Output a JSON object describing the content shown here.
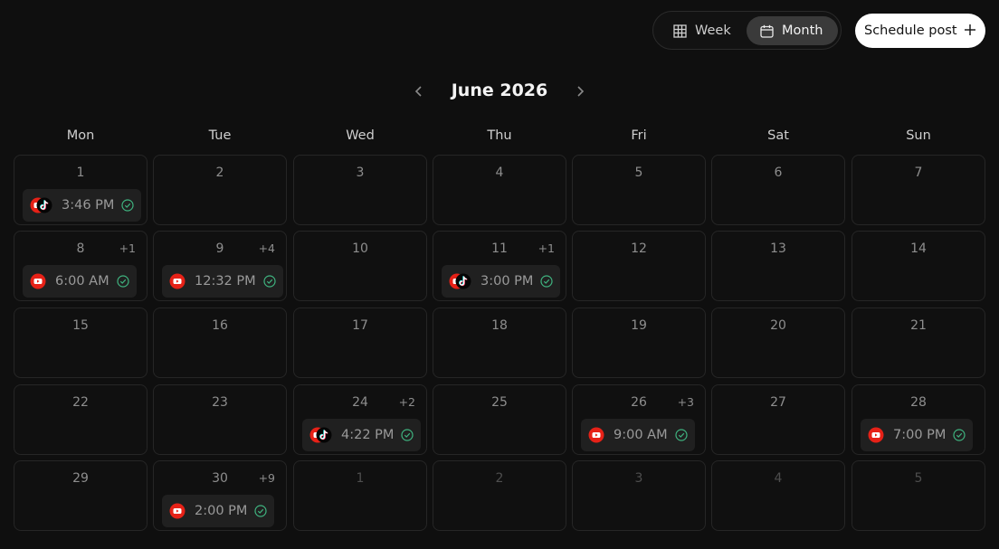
{
  "toolbar": {
    "week_label": "Week",
    "month_label": "Month",
    "week_icon": "grid-icon",
    "month_icon": "calendar-icon",
    "schedule_label": "Schedule post",
    "schedule_icon": "plus-icon"
  },
  "calendar": {
    "title": "June 2026",
    "prev_icon": "chevron-left-icon",
    "next_icon": "chevron-right-icon",
    "weekdays": [
      "Mon",
      "Tue",
      "Wed",
      "Thu",
      "Fri",
      "Sat",
      "Sun"
    ],
    "weeks": [
      [
        {
          "day": "1",
          "more": "",
          "post": {
            "time": "3:46 PM",
            "platforms": [
              "youtube",
              "tiktok"
            ]
          }
        },
        {
          "day": "2"
        },
        {
          "day": "3"
        },
        {
          "day": "4"
        },
        {
          "day": "5"
        },
        {
          "day": "6"
        },
        {
          "day": "7"
        }
      ],
      [
        {
          "day": "8",
          "more": "+1",
          "post": {
            "time": "6:00 AM",
            "platforms": [
              "youtube"
            ]
          }
        },
        {
          "day": "9",
          "more": "+4",
          "post": {
            "time": "12:32 PM",
            "platforms": [
              "youtube"
            ]
          }
        },
        {
          "day": "10"
        },
        {
          "day": "11",
          "more": "+1",
          "post": {
            "time": "3:00 PM",
            "platforms": [
              "youtube",
              "tiktok"
            ]
          }
        },
        {
          "day": "12"
        },
        {
          "day": "13"
        },
        {
          "day": "14"
        }
      ],
      [
        {
          "day": "15"
        },
        {
          "day": "16"
        },
        {
          "day": "17"
        },
        {
          "day": "18"
        },
        {
          "day": "19"
        },
        {
          "day": "20"
        },
        {
          "day": "21"
        }
      ],
      [
        {
          "day": "22"
        },
        {
          "day": "23"
        },
        {
          "day": "24",
          "more": "+2",
          "post": {
            "time": "4:22 PM",
            "platforms": [
              "youtube",
              "tiktok"
            ]
          }
        },
        {
          "day": "25"
        },
        {
          "day": "26",
          "more": "+3",
          "post": {
            "time": "9:00 AM",
            "platforms": [
              "youtube"
            ]
          }
        },
        {
          "day": "27"
        },
        {
          "day": "28",
          "more": "",
          "post": {
            "time": "7:00 PM",
            "platforms": [
              "youtube"
            ]
          }
        }
      ],
      [
        {
          "day": "29"
        },
        {
          "day": "30",
          "more": "+9",
          "post": {
            "time": "2:00 PM",
            "platforms": [
              "youtube"
            ]
          }
        },
        {
          "day": "1",
          "other": true
        },
        {
          "day": "2",
          "other": true
        },
        {
          "day": "3",
          "other": true
        },
        {
          "day": "4",
          "other": true
        },
        {
          "day": "5",
          "other": true
        }
      ]
    ]
  },
  "colors": {
    "background": "#0f0f0f",
    "youtube_red": "#e62117",
    "check_green": "#3fb37f",
    "chip_bg": "#202020"
  }
}
